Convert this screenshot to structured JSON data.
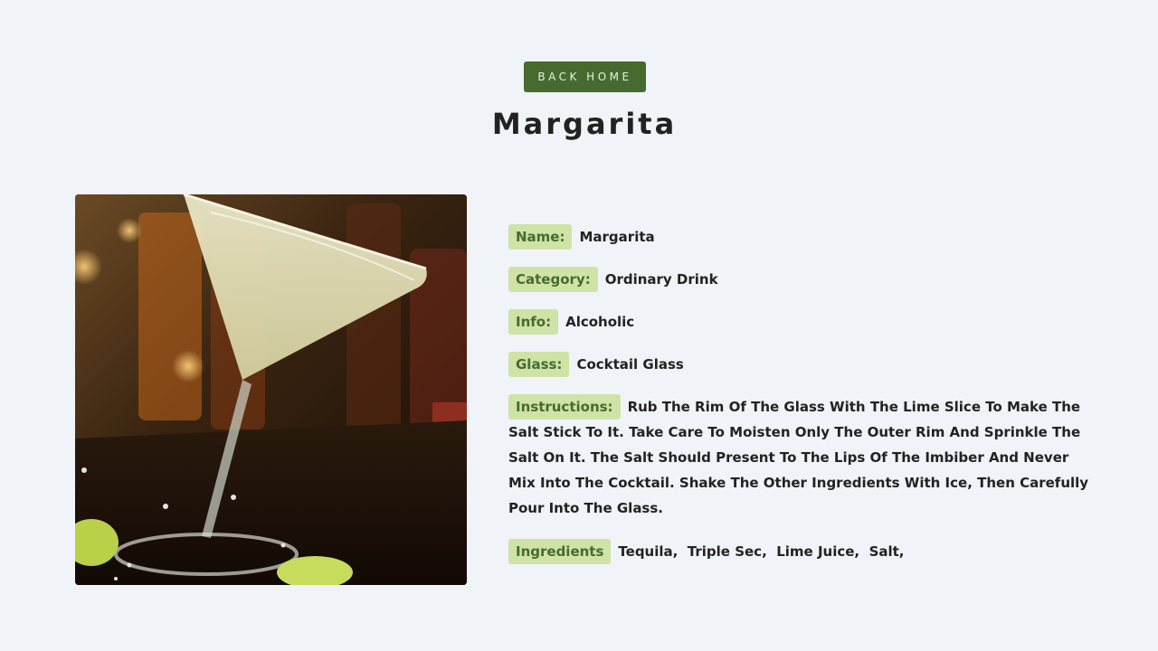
{
  "nav": {
    "back_label": "BACK HOME"
  },
  "drink": {
    "title": "Margarita",
    "image_alt": "Margarita cocktail in a glass with lime wedges",
    "fields": {
      "name_label": "Name:",
      "name_value": "Margarita",
      "category_label": "Category:",
      "category_value": "Ordinary Drink",
      "info_label": "Info:",
      "info_value": "Alcoholic",
      "glass_label": "Glass:",
      "glass_value": "Cocktail Glass",
      "instructions_label": "Instructions:",
      "instructions_value": "Rub The Rim Of The Glass With The Lime Slice To Make The Salt Stick To It. Take Care To Moisten Only The Outer Rim And Sprinkle The Salt On It. The Salt Should Present To The Lips Of The Imbiber And Never Mix Into The Cocktail. Shake The Other Ingredients With Ice, Then Carefully Pour Into The Glass.",
      "ingredients_label": "Ingredients",
      "ingredients": [
        "Tequila,",
        "Triple Sec,",
        "Lime Juice,",
        "Salt,"
      ]
    }
  },
  "colors": {
    "accent": "#476b2f",
    "tag_bg": "#cfe3a6",
    "page_bg": "#f0f4f8"
  }
}
